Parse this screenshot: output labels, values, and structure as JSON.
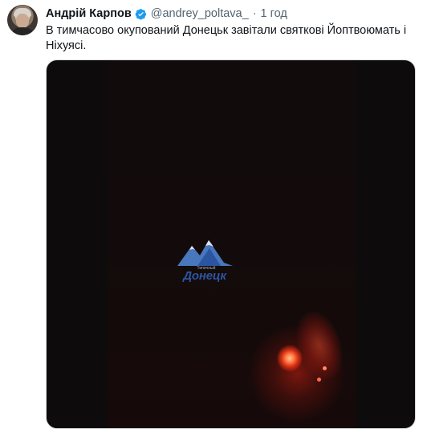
{
  "tweet": {
    "author_name": "Андрій Карпов",
    "handle": "@andrey_poltava_",
    "separator": "·",
    "time": "1 год",
    "text": "В тимчасово окупований Донецьк завітали святкові Йоптвоюмать і Ніхуясі."
  },
  "media": {
    "watermark_small": "Типичный",
    "watermark_main": "Донецк"
  },
  "colors": {
    "verified": "#1d9bf0",
    "muted": "#536471",
    "text": "#0f1419",
    "watermark": "#2d59aa"
  },
  "icons": {
    "verified": "verified-badge-icon",
    "avatar": "profile-photo"
  }
}
